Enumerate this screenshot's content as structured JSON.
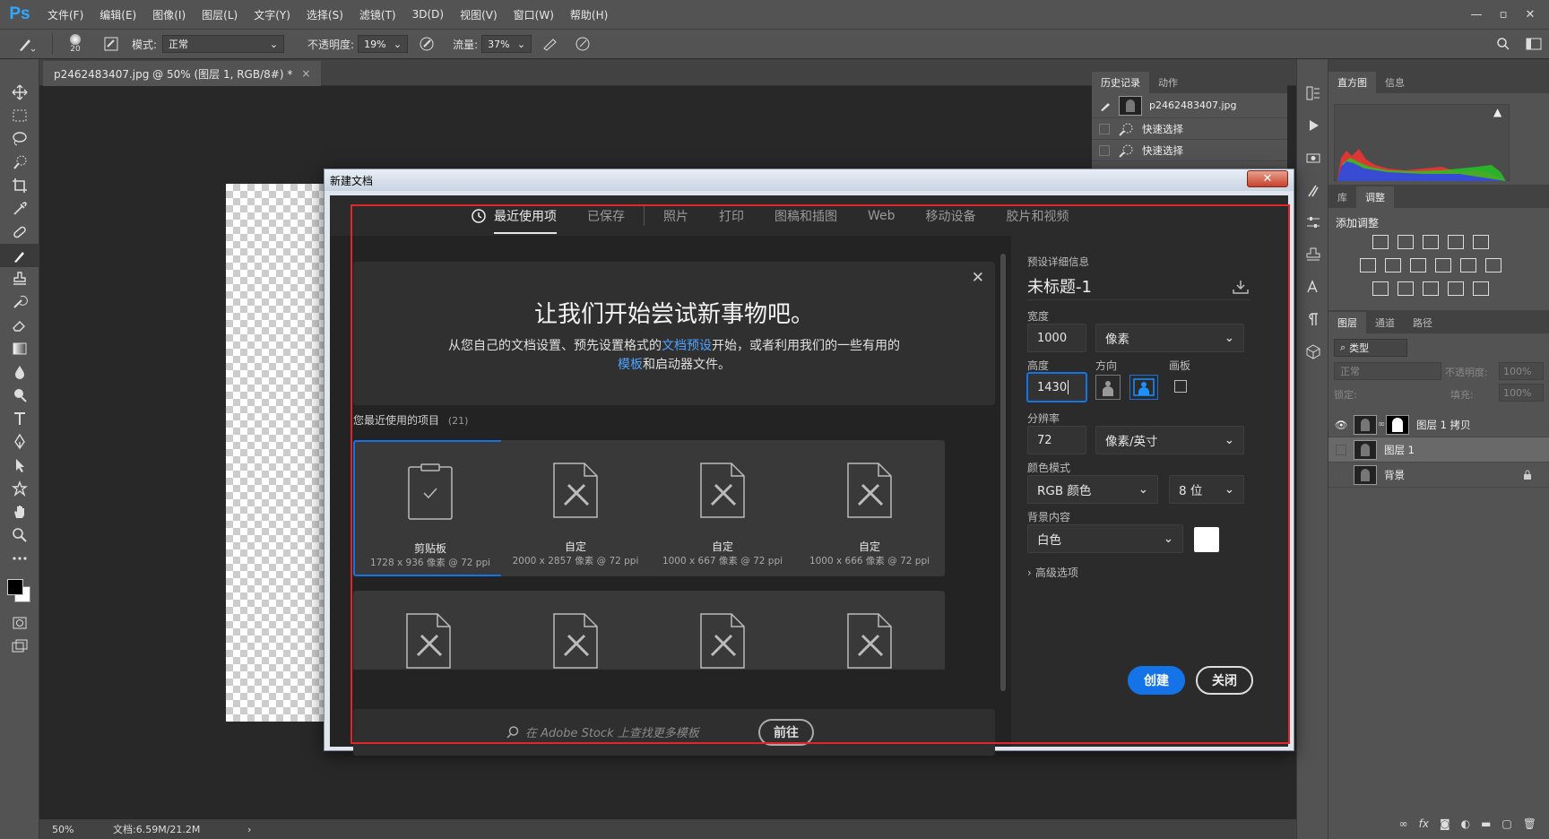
{
  "app": {
    "logo": "Ps",
    "menu": [
      "文件(F)",
      "编辑(E)",
      "图像(I)",
      "图层(L)",
      "文字(Y)",
      "选择(S)",
      "滤镜(T)",
      "3D(D)",
      "视图(V)",
      "窗口(W)",
      "帮助(H)"
    ],
    "window_controls": {
      "minimize": "—",
      "restore": "▫",
      "close": "✕"
    }
  },
  "options_bar": {
    "brush_size": "20",
    "mode_label": "模式:",
    "mode_value": "正常",
    "opacity_label": "不透明度:",
    "opacity_value": "19%",
    "flow_label": "流量:",
    "flow_value": "37%"
  },
  "document": {
    "tab_title": "p2462483407.jpg @ 50% (图层 1, RGB/8#) *",
    "tab_close": "×",
    "zoom": "50%",
    "doc_info": "文档:6.59M/21.2M",
    "status_arrow": "›"
  },
  "history_panel": {
    "tabs": [
      "历史记录",
      "动作"
    ],
    "snapshot": "p2462483407.jpg",
    "states": [
      "快速选择",
      "快速选择"
    ]
  },
  "histogram_panel": {
    "tabs": [
      "直方图",
      "信息"
    ],
    "warning": "▲"
  },
  "adjust_panel": {
    "tabs": [
      "库",
      "调整"
    ],
    "title": "添加调整"
  },
  "layers_panel": {
    "tabs": [
      "图层",
      "通道",
      "路径"
    ],
    "filter_label": "类型",
    "blend_mode": "正常",
    "opacity_label": "不透明度:",
    "opacity_value": "100%",
    "lock_label": "锁定:",
    "fill_label": "填充:",
    "fill_value": "100%",
    "layers": [
      {
        "name": "图层 1 拷贝",
        "visible": true
      },
      {
        "name": "图层 1",
        "visible": false
      },
      {
        "name": "背景",
        "visible": false
      }
    ],
    "footer_fx": "fx"
  },
  "dialog": {
    "title": "新建文档",
    "close": "✕",
    "categories": [
      "最近使用项",
      "已保存",
      "照片",
      "打印",
      "图稿和插图",
      "Web",
      "移动设备",
      "胶片和视频"
    ],
    "welcome": {
      "title": "让我们开始尝试新事物吧。",
      "text_a": "从您自己的文档设置、预先设置格式的",
      "link_a": "文档预设",
      "text_b": "开始，或者利用我们的一些有用的",
      "link_b": "模板",
      "text_c": "和启动器文件。",
      "close": "✕"
    },
    "recent_label": "您最近使用的项目",
    "recent_count": "(21)",
    "recent_items": [
      {
        "name": "剪贴板",
        "meta": "1728 x 936 像素 @ 72 ppi",
        "selected": true
      },
      {
        "name": "自定",
        "meta": "2000 x 2857 像素 @ 72 ppi"
      },
      {
        "name": "自定",
        "meta": "1000 x 667 像素 @ 72 ppi"
      },
      {
        "name": "自定",
        "meta": "1000 x 666 像素 @ 72 ppi"
      }
    ],
    "stock_placeholder": "在 Adobe Stock 上查找更多模板",
    "stock_button": "前往",
    "preset": {
      "section_label": "预设详细信息",
      "name": "未标题-1",
      "width_label": "宽度",
      "width_value": "1000",
      "width_unit": "像素",
      "height_label": "高度",
      "height_value": "1430",
      "orientation_label": "方向",
      "artboard_label": "画板",
      "resolution_label": "分辨率",
      "resolution_value": "72",
      "resolution_unit": "像素/英寸",
      "color_mode_label": "颜色模式",
      "color_mode_value": "RGB 颜色",
      "bit_depth": "8 位",
      "background_label": "背景内容",
      "background_value": "白色",
      "advanced_label": "高级选项",
      "create_button": "创建",
      "close_button": "关闭"
    }
  },
  "colors": {
    "accent": "#1473e6",
    "link": "#4ea2ff",
    "highlight_frame": "#e0262b"
  }
}
